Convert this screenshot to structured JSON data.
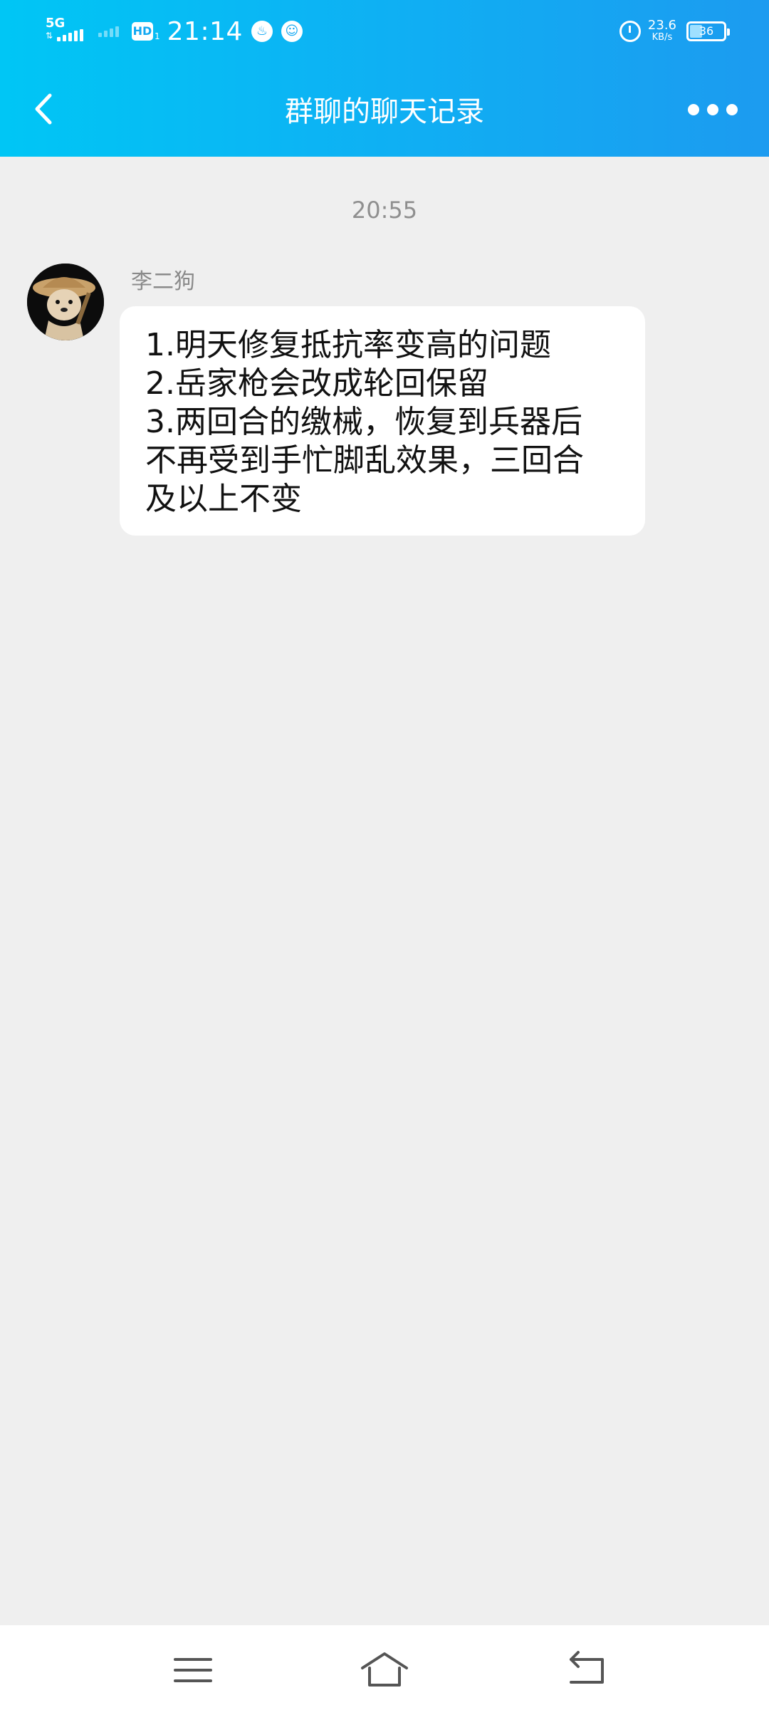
{
  "status_bar": {
    "network": "5G",
    "hd_label": "HD",
    "hd_sub": "1",
    "time": "21:14",
    "speed_value": "23.6",
    "speed_unit": "KB/s",
    "battery": "36",
    "battery_level": 0.36
  },
  "header": {
    "title": "群聊的聊天记录",
    "back_icon": "chevron-left-icon",
    "more_icon": "more-horizontal-icon"
  },
  "chat": {
    "timestamp": "20:55",
    "messages": [
      {
        "sender": "李二狗",
        "lines": [
          "1.明天修复抵抗率变高的问题",
          "2.岳家枪会改成轮回保留",
          "3.两回合的缴械，恢复到兵器后",
          "不再受到手忙脚乱效果，三回合",
          "及以上不变"
        ]
      }
    ]
  },
  "bottom_nav": {
    "icons": [
      "menu-icon",
      "home-icon",
      "back-icon"
    ]
  },
  "colors": {
    "header_start": "#00c6f5",
    "header_end": "#1c9bf0",
    "background": "#efefef",
    "bubble": "#ffffff"
  }
}
